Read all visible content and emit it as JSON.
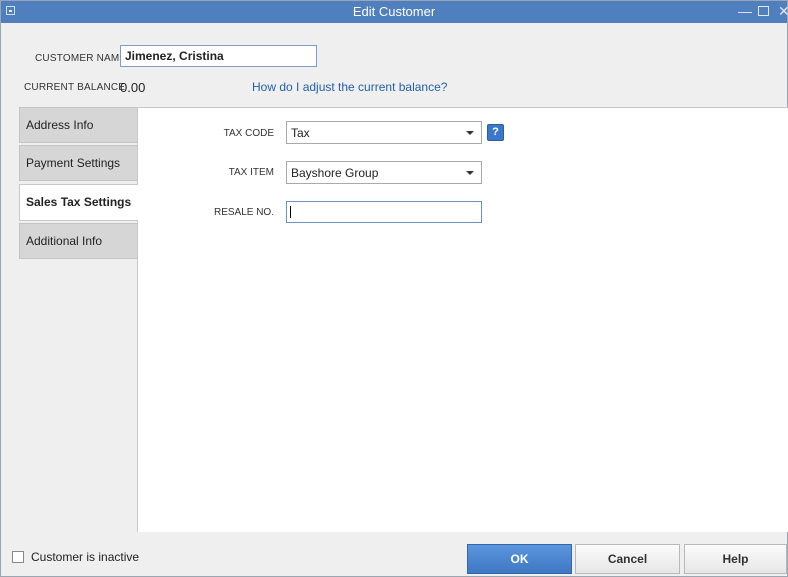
{
  "window": {
    "title": "Edit Customer"
  },
  "customer": {
    "name_label": "CUSTOMER NAME",
    "name_value": "Jimenez, Cristina",
    "balance_label": "CURRENT BALANCE",
    "balance_value": "0.00",
    "adjust_link": "How do I adjust the current balance?"
  },
  "tabs": [
    {
      "label": "Address Info"
    },
    {
      "label": "Payment Settings"
    },
    {
      "label": "Sales Tax Settings",
      "active": true
    },
    {
      "label": "Additional Info"
    }
  ],
  "sales_tax": {
    "tax_code_label": "TAX CODE",
    "tax_code_value": "Tax",
    "help_icon": "?",
    "tax_item_label": "TAX ITEM",
    "tax_item_value": "Bayshore Group",
    "resale_label": "RESALE NO.",
    "resale_value": ""
  },
  "footer": {
    "inactive_label": "Customer is inactive",
    "ok_label": "OK",
    "cancel_label": "Cancel",
    "help_label": "Help"
  },
  "colors": {
    "titlebar": "#4f7fbe",
    "ok_button": "#4a84cf",
    "link": "#2460a8"
  }
}
